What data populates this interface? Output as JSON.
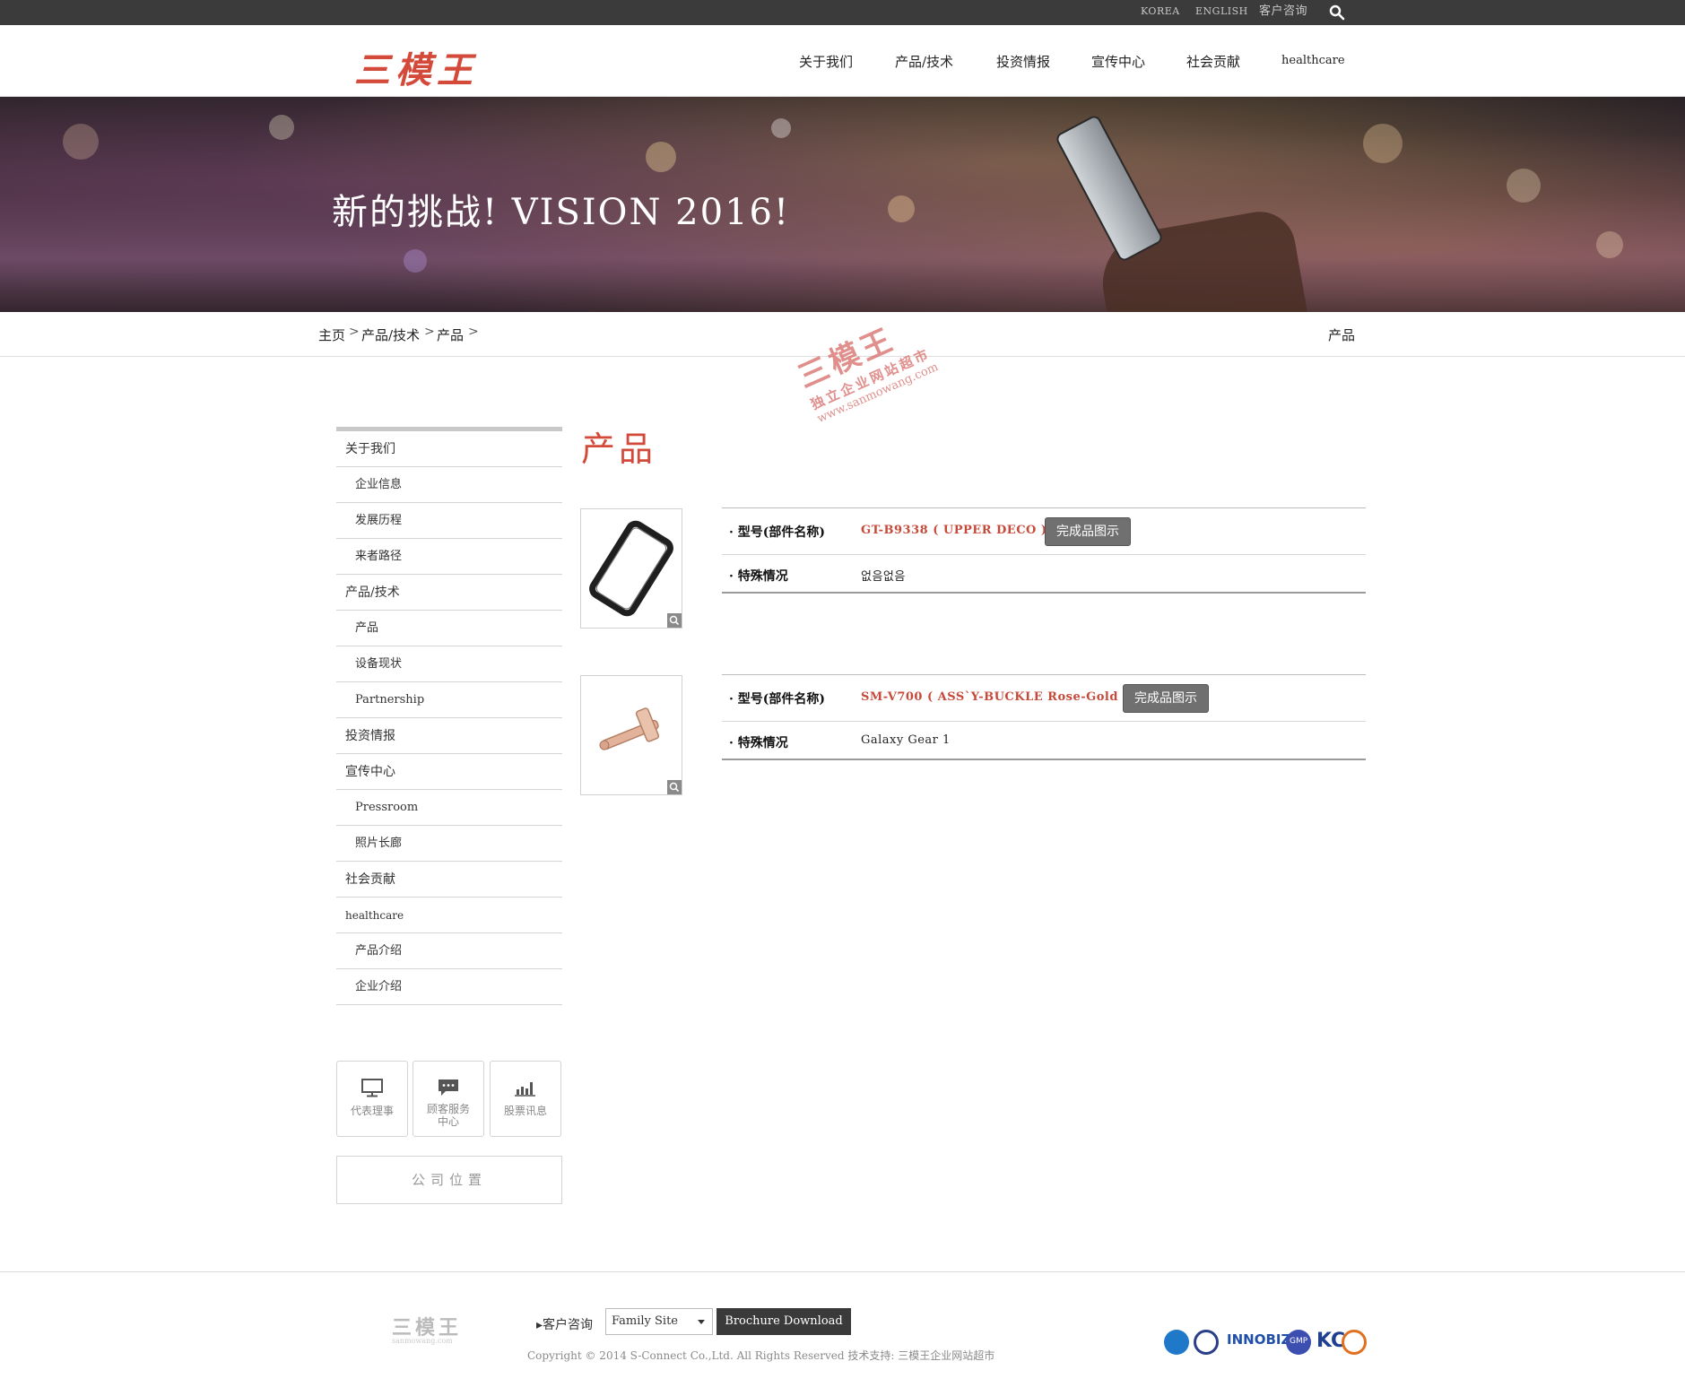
{
  "topbar": {
    "korea": "KOREA",
    "english": "ENGLISH",
    "consult": "客户咨询",
    "search_icon": "search-icon"
  },
  "header": {
    "logo": "三模王",
    "nav": [
      "关于我们",
      "产品/技术",
      "投资情报",
      "宣传中心",
      "社会贡献",
      "healthcare"
    ]
  },
  "hero": {
    "title": "新的挑战! VISION 2016!"
  },
  "breadcrumb": {
    "items": [
      "主页",
      "产品/技术",
      "产品"
    ],
    "current": "产品"
  },
  "watermark": {
    "brand": "三模王",
    "tagline": "独立企业网站超市",
    "url": "www.sanmowang.com"
  },
  "sidebar": {
    "items": [
      {
        "label": "关于我们",
        "level": 1
      },
      {
        "label": "企业信息",
        "level": 2
      },
      {
        "label": "发展历程",
        "level": 2
      },
      {
        "label": "来者路径",
        "level": 2
      },
      {
        "label": "产品/技术",
        "level": 1
      },
      {
        "label": "产品",
        "level": 2
      },
      {
        "label": "设备现状",
        "level": 2
      },
      {
        "label": "Partnership",
        "level": 2
      },
      {
        "label": "投资情报",
        "level": 1
      },
      {
        "label": "宣传中心",
        "level": 1
      },
      {
        "label": "Pressroom",
        "level": 2
      },
      {
        "label": "照片长廊",
        "level": 2
      },
      {
        "label": "社会贡献",
        "level": 1
      },
      {
        "label": "healthcare",
        "level": 1
      },
      {
        "label": "产品介绍",
        "level": 2
      },
      {
        "label": "企业介绍",
        "level": 2
      }
    ],
    "quick": [
      {
        "label": "代表理事",
        "icon": "monitor-icon"
      },
      {
        "label": "顾客服务\n中心",
        "icon": "chat-icon"
      },
      {
        "label": "股票讯息",
        "icon": "bar-chart-icon"
      }
    ],
    "location_button": "公司位置"
  },
  "main": {
    "title": "产品",
    "products": [
      {
        "model_label": "型号(部件名称)",
        "model_value": "GT-B9338 ( UPPER DECO )",
        "button": "完成品图示",
        "special_label": "特殊情况",
        "special_value": "없음없음"
      },
      {
        "model_label": "型号(部件名称)",
        "model_value": "SM-V700 ( ASS`Y-BUCKLE Rose-Gold )",
        "button": "完成品图示",
        "special_label": "特殊情况",
        "special_value": "Galaxy Gear 1"
      }
    ]
  },
  "footer": {
    "logo": "三模王",
    "logo_sub": "sanmowang.com",
    "consult": "客户咨询",
    "family_site": "Family Site",
    "brochure": "Brochure Download",
    "copyright": "Copyright © 2014 S-Connect Co.,Ltd. All Rights Reserved 技术支持: 三模王企业网站超市",
    "certs": [
      "INNOBIZ",
      "GMP",
      "KC"
    ]
  },
  "colors": {
    "accent": "#d34a3a",
    "topbar": "#3b3b3b",
    "button": "#707070"
  }
}
